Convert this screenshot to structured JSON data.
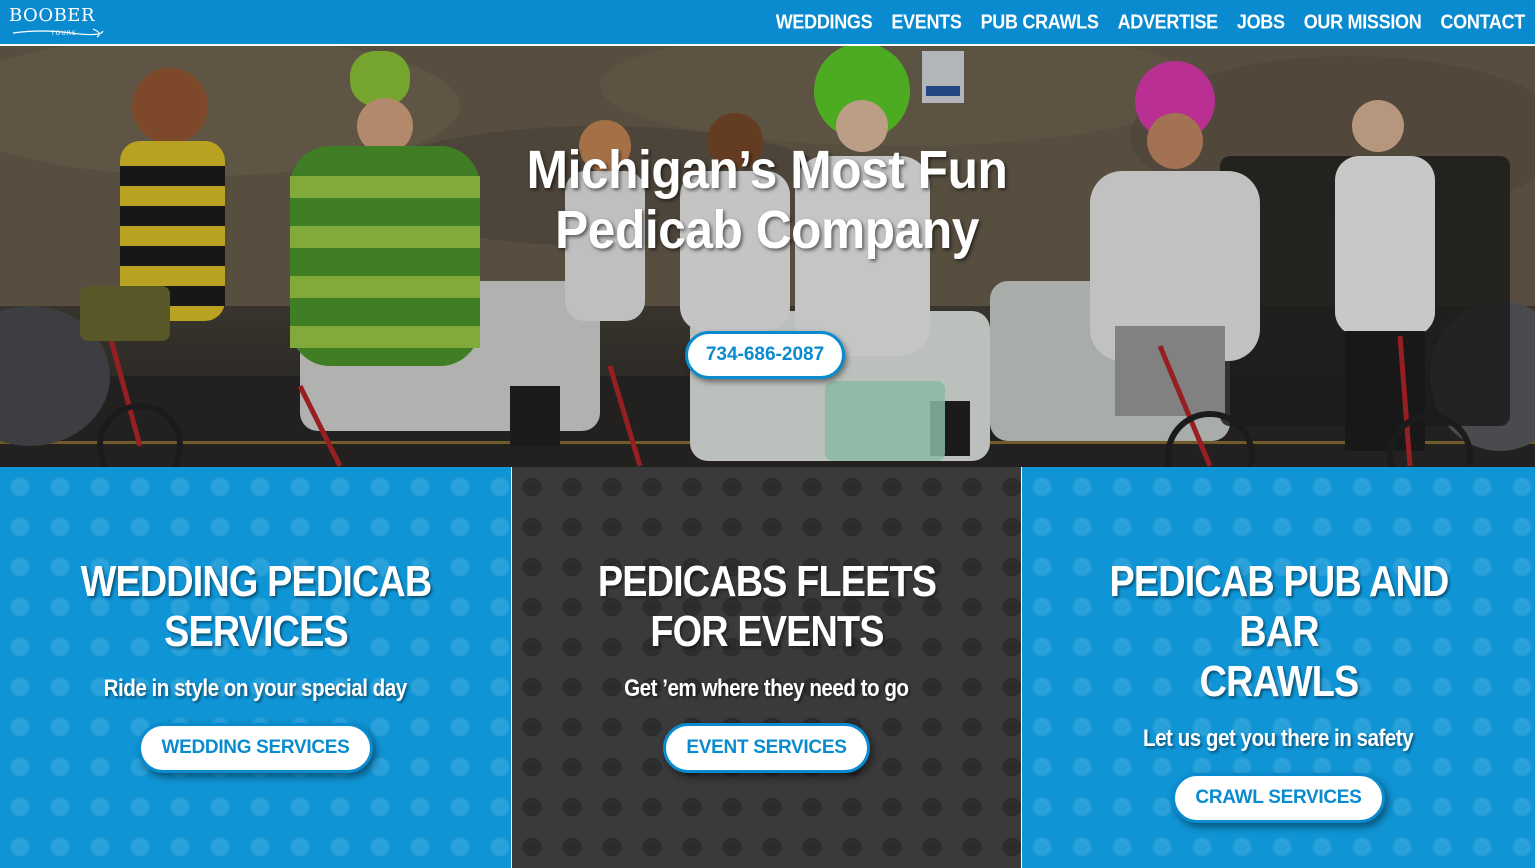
{
  "brand": {
    "logo_text": "BOOBER",
    "logo_sub": "TOURS",
    "colors": {
      "primary": "#0a8bd0",
      "panel_blue": "#0f95d6",
      "panel_dark": "#3a3a3a"
    }
  },
  "nav": {
    "items": [
      {
        "label": "WEDDINGS"
      },
      {
        "label": "EVENTS"
      },
      {
        "label": "PUB CRAWLS"
      },
      {
        "label": "ADVERTISE"
      },
      {
        "label": "JOBS"
      },
      {
        "label": "OUR MISSION"
      },
      {
        "label": "CONTACT"
      }
    ]
  },
  "hero": {
    "title_line1": "Michigan’s Most Fun",
    "title_line2": "Pedicab Company",
    "phone": "734-686-2087"
  },
  "panels": [
    {
      "title_line1": "WEDDING PEDICAB",
      "title_line2": "SERVICES",
      "subtitle": "Ride in style on your special day",
      "button": "WEDDING SERVICES"
    },
    {
      "title_line1": "PEDICABS FLEETS",
      "title_line2": "FOR EVENTS",
      "subtitle": "Get ’em where they need to go",
      "button": "EVENT SERVICES"
    },
    {
      "title_line1": "PEDICAB PUB AND BAR",
      "title_line2": "CRAWLS",
      "subtitle": "Let us get you there in safety",
      "button": "CRAWL SERVICES"
    }
  ]
}
